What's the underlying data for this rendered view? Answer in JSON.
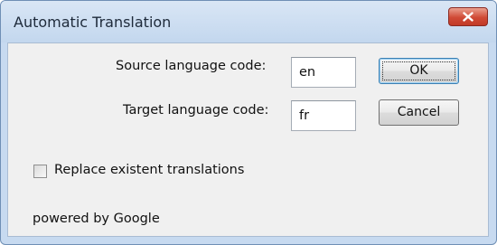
{
  "window": {
    "title": "Automatic Translation"
  },
  "form": {
    "source_label": "Source language code:",
    "source_value": "en",
    "target_label": "Target language code:",
    "target_value": "fr"
  },
  "buttons": {
    "ok_label": "OK",
    "cancel_label": "Cancel"
  },
  "options": {
    "replace_label": "Replace existent translations",
    "replace_checked": false
  },
  "footer": {
    "powered_by": "powered by Google"
  },
  "icons": {
    "close": "close-icon"
  },
  "colors": {
    "close_button": "#d04a36",
    "title_bar": "#c7daf0",
    "dialog_body": "#f0f0f0"
  }
}
